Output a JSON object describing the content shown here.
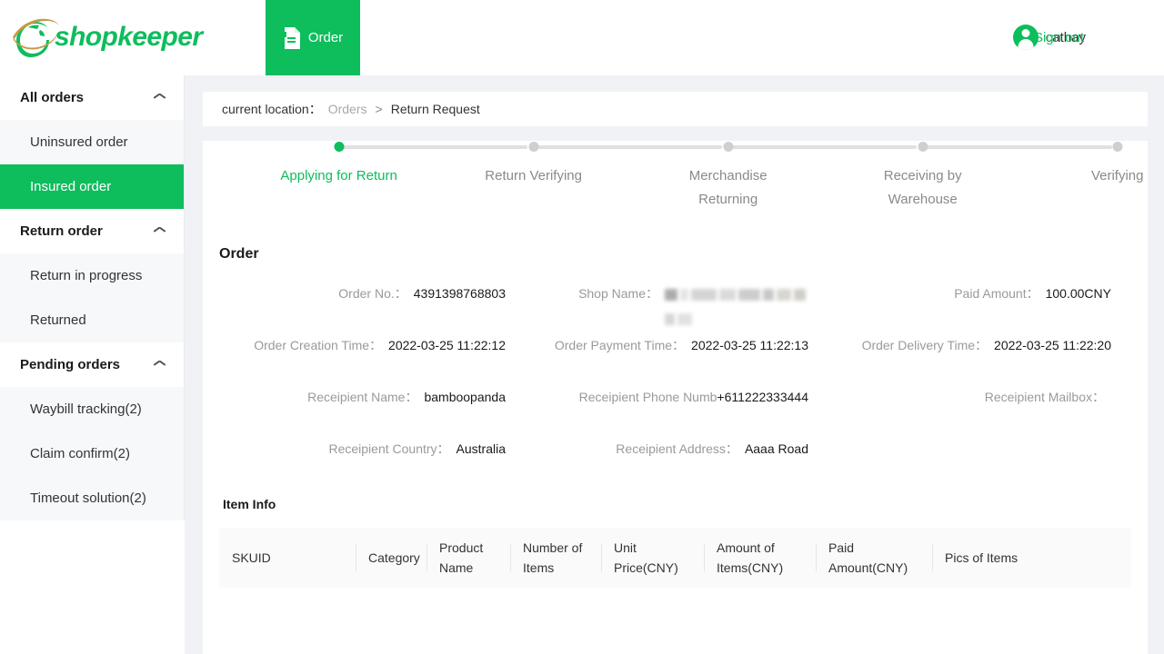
{
  "brand": {
    "name": "shopkeeper",
    "color": "#0ebd5c"
  },
  "header": {
    "tab_label": "Order",
    "user_name": "cathay",
    "signout_label": "Sign out"
  },
  "sidebar": {
    "groups": [
      {
        "label": "All orders",
        "items": [
          {
            "label": "Uninsured order",
            "active": false
          },
          {
            "label": "Insured order",
            "active": true
          }
        ]
      },
      {
        "label": "Return order",
        "items": [
          {
            "label": "Return in progress",
            "active": false
          },
          {
            "label": "Returned",
            "active": false
          }
        ]
      },
      {
        "label": "Pending orders",
        "items": [
          {
            "label": "Waybill tracking(2)",
            "active": false
          },
          {
            "label": "Claim confirm(2)",
            "active": false
          },
          {
            "label": "Timeout solution(2)",
            "active": false
          }
        ]
      }
    ]
  },
  "breadcrumb": {
    "prefix": "current location：",
    "parent": "Orders",
    "separator": ">",
    "current": "Return Request"
  },
  "stepper": {
    "steps": [
      {
        "label": "Applying for Return",
        "state": "done"
      },
      {
        "label": "Return Verifying",
        "state": "pending"
      },
      {
        "label": "Merchandise Returning",
        "state": "pending"
      },
      {
        "label": "Receiving by Warehouse",
        "state": "pending"
      },
      {
        "label": "Verifying",
        "state": "pending"
      }
    ]
  },
  "order": {
    "section_title": "Order",
    "fields": {
      "order_no_label": "Order No.：",
      "order_no_value": "4391398768803",
      "shop_name_label": "Shop Name：",
      "shop_name_value": "",
      "paid_amount_label": "Paid Amount：",
      "paid_amount_value": "100.00CNY",
      "creation_time_label": "Order Creation Time：",
      "creation_time_value": "2022-03-25 11:22:12",
      "payment_time_label": "Order Payment Time：",
      "payment_time_value": "2022-03-25 11:22:13",
      "delivery_time_label": "Order Delivery Time：",
      "delivery_time_value": "2022-03-25 11:22:20",
      "recipient_name_label": "Receipient Name：",
      "recipient_name_value": "bamboopanda",
      "recipient_phone_label": "Receipient Phone Numb",
      "recipient_phone_value": "+611222333444",
      "recipient_mailbox_label": "Receipient Mailbox：",
      "recipient_mailbox_value": "",
      "recipient_country_label": "Receipient Country：",
      "recipient_country_value": "Australia",
      "recipient_address_label": "Receipient Address：",
      "recipient_address_value": "Aaaa Road"
    }
  },
  "item_info": {
    "title": "Item Info",
    "columns": [
      "SKUID",
      "Category",
      "Product Name",
      "Number of Items",
      "Unit Price(CNY)",
      "Amount of Items(CNY)",
      "Paid Amount(CNY)",
      "Pics of Items"
    ]
  },
  "icons": {
    "document": "document-icon",
    "avatar": "avatar-icon",
    "chevron_up": "chevron-up-icon"
  }
}
